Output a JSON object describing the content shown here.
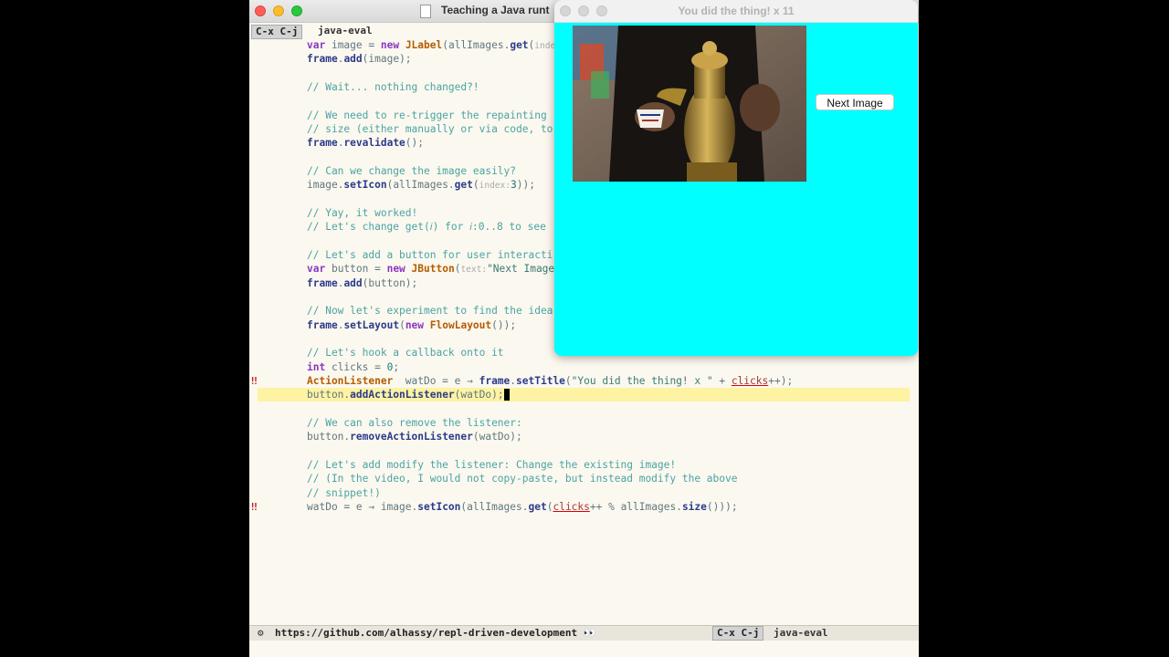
{
  "window": {
    "title": "Teaching a Java runt"
  },
  "tab_bar": {
    "keys": "C-x C-j",
    "mode": "java-eval"
  },
  "code_lines": [
    {
      "t": [
        "kw:var",
        "p: image = ",
        "kw:new",
        "p: ",
        "ty:JLabel",
        "p:(allImages.",
        "fn:get",
        "p:(",
        "hint:inde"
      ]
    },
    {
      "t": [
        "fn:frame",
        "p:.",
        "fn:add",
        "p:(image);"
      ]
    },
    {
      "t": []
    },
    {
      "t": [
        "cm:// Wait... nothing changed?!"
      ]
    },
    {
      "t": []
    },
    {
      "t": [
        "cm:// We need to re-trigger the repainting "
      ]
    },
    {
      "t": [
        "cm:// size (either manually or via code, to"
      ]
    },
    {
      "t": [
        "fn:frame",
        "p:.",
        "fn:revalidate",
        "p:();"
      ]
    },
    {
      "t": []
    },
    {
      "t": [
        "cm:// Can we change the image easily?"
      ]
    },
    {
      "t": [
        "p:image.",
        "fn:setIcon",
        "p:(allImages.",
        "fn:get",
        "p:(",
        "hint:index:",
        "num:3",
        "p:));"
      ]
    },
    {
      "t": []
    },
    {
      "t": [
        "cm:// Yay, it worked!"
      ]
    },
    {
      "t": [
        "cm:// Let's change get(𝑖) for 𝑖:0..8 to see"
      ]
    },
    {
      "t": []
    },
    {
      "t": [
        "cm:// Let's add a button for user interacti"
      ]
    },
    {
      "t": [
        "kw:var",
        "p: button = ",
        "kw:new",
        "p: ",
        "ty:JButton",
        "p:(",
        "hint:text:",
        "st:\"Next Image"
      ]
    },
    {
      "t": [
        "fn:frame",
        "p:.",
        "fn:add",
        "p:(button);"
      ]
    },
    {
      "t": []
    },
    {
      "t": [
        "cm:// Now let's experiment to find the idea"
      ]
    },
    {
      "t": [
        "fn:frame",
        "p:.",
        "fn:setLayout",
        "p:(",
        "kw:new",
        "p: ",
        "ty:FlowLayout",
        "p:());"
      ]
    },
    {
      "t": []
    },
    {
      "t": [
        "cm:// Let's hook a callback onto it"
      ]
    },
    {
      "t": [
        "kw:int",
        "p: clicks = ",
        "num:0",
        "p:;"
      ]
    },
    {
      "t": [
        "ty:ActionListener",
        "p:  watDo = e → ",
        "fn:frame",
        "p:.",
        "fn:setTitle",
        "p:(",
        "st:\"You did the thing! x \"",
        "p: + ",
        "err:clicks",
        "p:++);"
      ],
      "gutter": "‼"
    },
    {
      "t": [
        "p:button.",
        "fn:addActionListener",
        "p:(watDo);",
        "cursor: "
      ],
      "highlight": true
    },
    {
      "t": []
    },
    {
      "t": [
        "cm:// We can also remove the listener:"
      ]
    },
    {
      "t": [
        "p:button.",
        "fn:removeActionListener",
        "p:(watDo);"
      ]
    },
    {
      "t": []
    },
    {
      "t": [
        "cm:// Let's add modify the listener: Change the existing image!"
      ]
    },
    {
      "t": [
        "cm:// (In the video, I would not copy-paste, but instead modify the above"
      ]
    },
    {
      "t": [
        "cm:// snippet!)"
      ]
    },
    {
      "t": [
        "p:watDo = e → image.",
        "fn:setIcon",
        "p:(allImages.",
        "fn:get",
        "p:(",
        "err:clicks",
        "p:++ % allImages.",
        "fn:size",
        "p:()));"
      ],
      "gutter": "‼"
    }
  ],
  "mode_line": {
    "url": "https://github.com/alhassy/repl-driven-development 👀",
    "keys": "C-x C-j",
    "mode": "java-eval"
  },
  "swing": {
    "title": "You did the thing! x 11",
    "button_label": "Next Image",
    "background": "#00ffff"
  }
}
